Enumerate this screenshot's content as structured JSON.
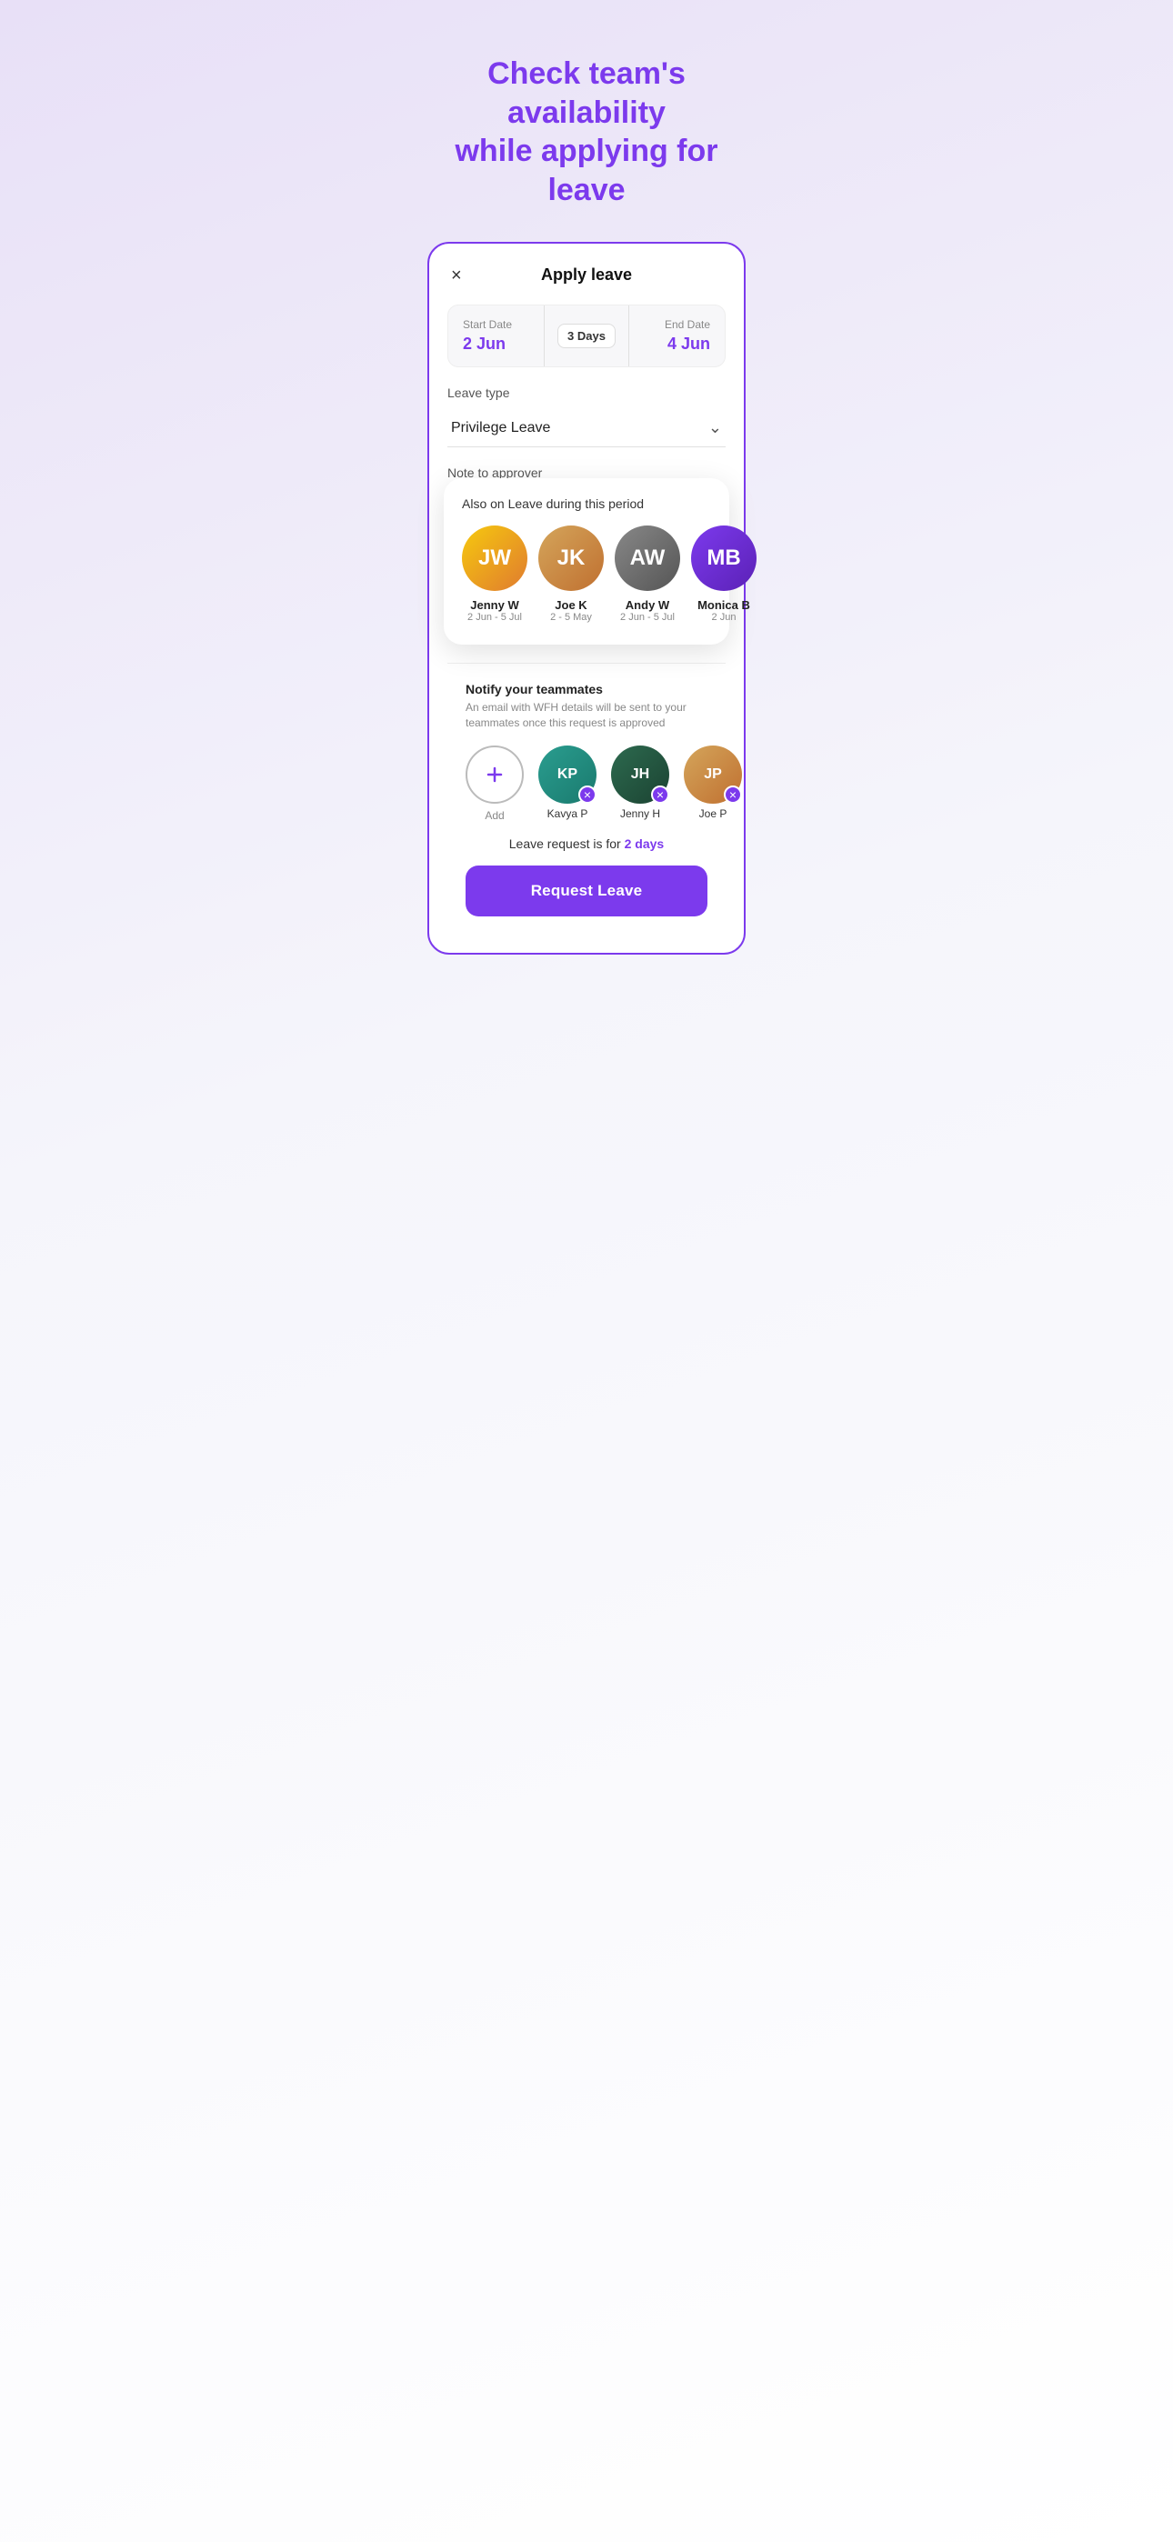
{
  "hero": {
    "line1_plain": "Check ",
    "line1_accent": "team's availability",
    "line2": "while applying for leave"
  },
  "card": {
    "title": "Apply leave",
    "close_label": "×",
    "start_date_label": "Start Date",
    "start_date_value": "2 Jun",
    "days_badge": "3 Days",
    "end_date_label": "End Date",
    "end_date_value": "4 Jun",
    "leave_type_label": "Leave type",
    "leave_type_value": "Privilege Leave",
    "note_label": "Note to approver"
  },
  "also_on_leave": {
    "title": "Also on Leave during this period",
    "people": [
      {
        "name": "Jenny W",
        "dates": "2 Jun - 5 Jul",
        "initials": "JW",
        "color_class": "jenny-w"
      },
      {
        "name": "Joe K",
        "dates": "2 - 5 May",
        "initials": "JK",
        "color_class": "joe-k"
      },
      {
        "name": "Andy W",
        "dates": "2 Jun - 5 Jul",
        "initials": "AW",
        "color_class": "andy-w"
      },
      {
        "name": "Monica B",
        "dates": "2 Jun",
        "initials": "MB",
        "color_class": "monica-b"
      }
    ]
  },
  "notify": {
    "title": "Notify your teammates",
    "description": "An email with WFH details will be sent to your teammates once this request is approved",
    "add_label": "Add",
    "people": [
      {
        "name": "Kavya P",
        "initials": "KP",
        "color_class": "kavya"
      },
      {
        "name": "Jenny H",
        "initials": "JH",
        "color_class": "jennyh"
      },
      {
        "name": "Joe P",
        "initials": "JP",
        "color_class": "joep"
      }
    ]
  },
  "leave_summary": {
    "text_plain": "Leave request is for ",
    "days_bold": "2 days"
  },
  "cta": {
    "label": "Request Leave"
  },
  "colors": {
    "accent": "#7c3aed"
  }
}
